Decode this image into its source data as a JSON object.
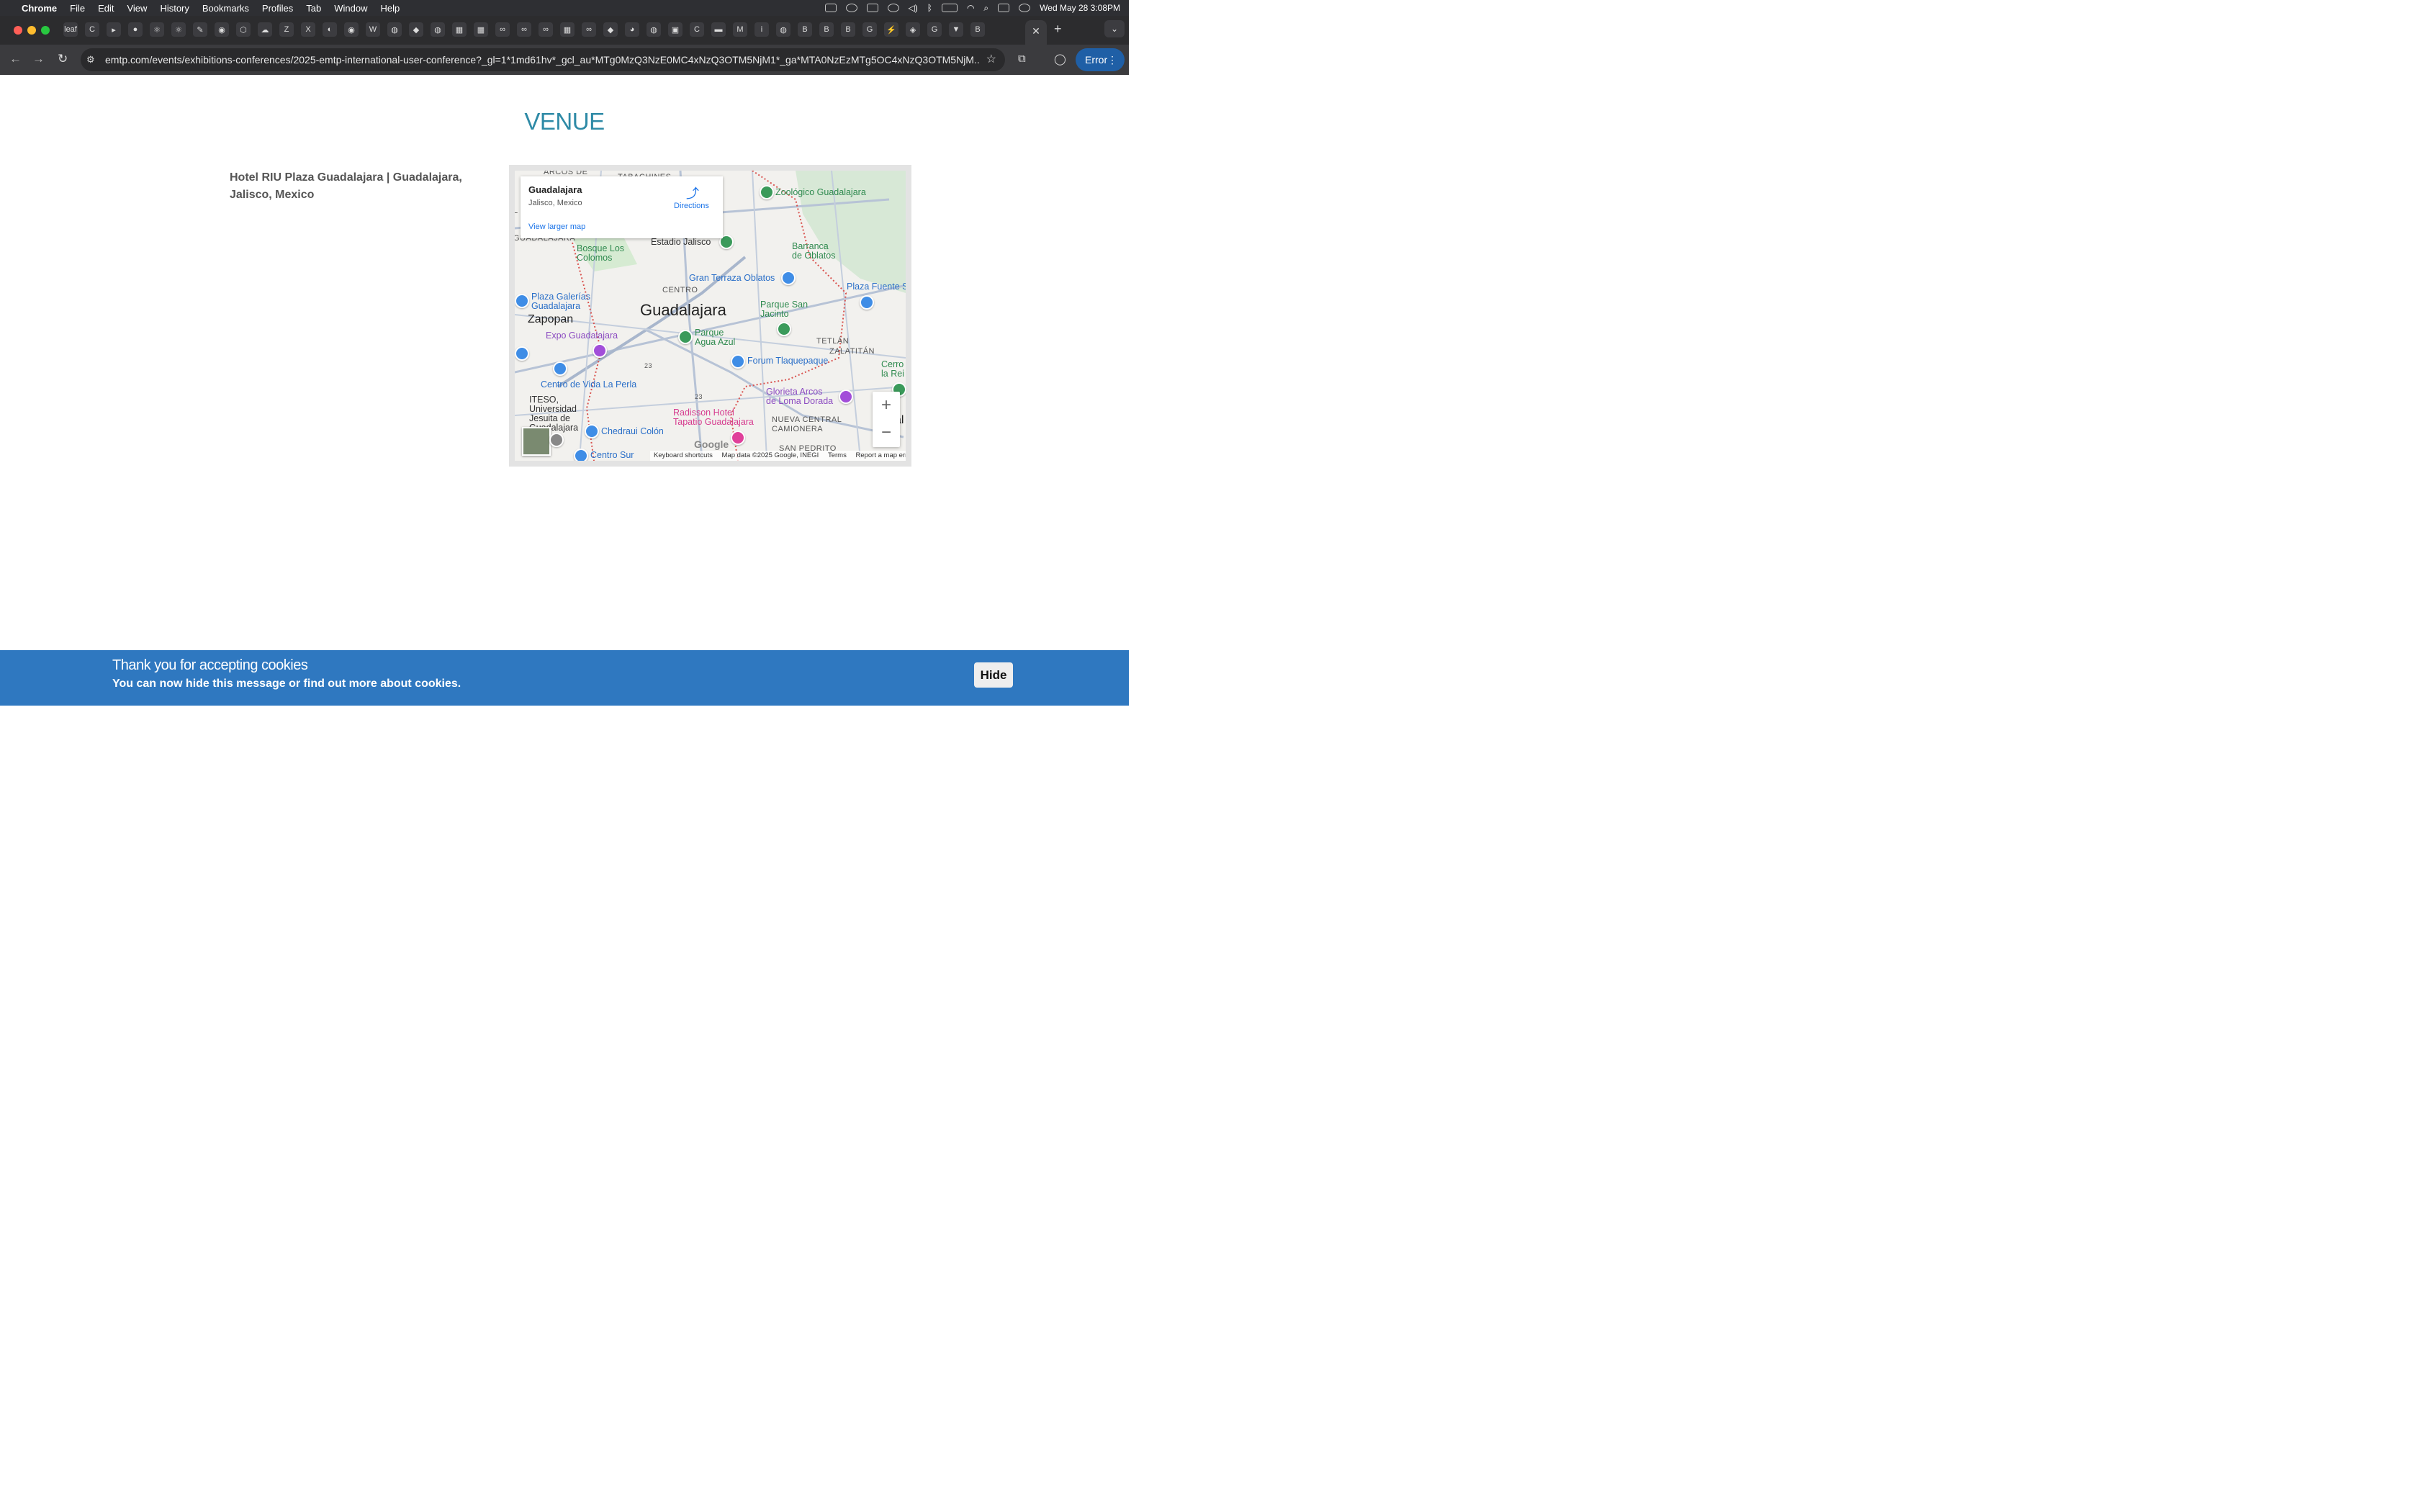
{
  "menubar": {
    "app_name": "Chrome",
    "items": [
      "File",
      "Edit",
      "View",
      "History",
      "Bookmarks",
      "Profiles",
      "Tab",
      "Window",
      "Help"
    ],
    "clock": "Wed May 28  3:08PM",
    "status_icons": [
      "wd-icon",
      "creative-cloud-icon",
      "window-icon",
      "time-machine-icon",
      "volume-icon",
      "bluetooth-icon",
      "battery-icon",
      "wifi-icon",
      "search-icon",
      "control-center-icon",
      "siri-icon"
    ]
  },
  "browser": {
    "tabs": {
      "icons": [
        "leaf",
        "C",
        "▸",
        "●",
        "⚛",
        "⚛",
        "✎",
        "◉",
        "⬡",
        "☁",
        "Z",
        "X",
        "◐",
        "◉",
        "W",
        "◍",
        "◆",
        "◍",
        "▦",
        "▦",
        "∞",
        "∞",
        "∞",
        "▦",
        "∞",
        "◆",
        "◕",
        "◍",
        "▣",
        "C",
        "▬",
        "M",
        "i",
        "◍",
        "B",
        "B",
        "B",
        "G",
        "⚡",
        "◈",
        "G",
        "▼",
        "B",
        "⟨⟩",
        "◆"
      ],
      "active_close": "✕",
      "new_tab": "+",
      "tab_menu": "⌄"
    },
    "url": "emtp.com/events/exhibitions-conferences/2025-emtp-international-user-conference?_gl=1*1md61hv*_gcl_au*MTg0MzQ3NzE0MC4xNzQ3OTM5NjM1*_ga*MTA0NzEzMTg5OC4xNzQ3OTM5NjM...",
    "error_label": "Error",
    "nav_icons": {
      "back": "←",
      "forward": "→",
      "reload": "↻",
      "bookmark": "☆",
      "extensions": "⧉",
      "profile": "◯",
      "menu": "⋮"
    }
  },
  "page": {
    "section_title": "VENUE",
    "venue_text": "Hotel RIU Plaza Guadalajara | Guadalajara, Jalisco, Mexico"
  },
  "map": {
    "info_name": "Guadalajara",
    "info_sub": "Jalisco, Mexico",
    "info_link": "View larger map",
    "directions": "Directions",
    "zoom_in": "+",
    "zoom_out": "−",
    "google": "Google",
    "attribution": {
      "shortcuts": "Keyboard shortcuts",
      "data": "Map data ©2025 Google, INEGI",
      "terms": "Terms",
      "report": "Report a map error"
    },
    "labels": {
      "arcos": "ARCOS DE",
      "tabachines": "TABACHINES",
      "zoologico": "Zoológico Guadalajara",
      "l": "L",
      "guadalajara_frag": "GUADALAJARA",
      "bosque": "Bosque Los\nColomos",
      "estadio": "Estadio Jalisco",
      "barranca": "Barranca\nde Oblatos",
      "gran_terraza": "Gran Terraza Oblatos",
      "centro": "CENTRO",
      "plaza_galerias": "Plaza Galerías\nGuadalajara",
      "plaza_fuente": "Plaza Fuente S",
      "zapopan": "Zapopan",
      "guadalajara": "Guadalajara",
      "parque_san_jacinto": "Parque San\nJacinto",
      "expo": "Expo Guadalajara",
      "parque_agua_azul": "Parque\nAgua Azul",
      "tetlan": "TETLÁN",
      "zalatitan": "ZALATITÁN",
      "forum": "Forum Tlaquepaque",
      "cerro": "Cerro\nla Rei",
      "centro_vida": "Centro de Vida La Perla",
      "iteso": "ITESO,\nUniversidad\nJesuita de\nGuadalajara",
      "glorieta": "Glorieta Arcos\nde Loma Dorada",
      "radisson": "Radisson Hotel\nTapatio Guadalajara",
      "nueva_central": "NUEVA CENTRAL\nCAMIONERA",
      "al": "al",
      "z": "Z",
      "chedraui": "Chedraui Colón",
      "san_pedrito": "SAN PEDRITO",
      "centro_sur": "Centro Sur",
      "hwy23a": "23",
      "hwy23b": "23"
    }
  },
  "cookie": {
    "heading": "Thank you for accepting cookies",
    "text": "You can now hide this message or find out more about cookies.",
    "hide": "Hide"
  },
  "colors": {
    "accent_title": "#2e8aa6",
    "cookie_bg": "#2f78c0",
    "link_blue": "#1a73e8"
  }
}
